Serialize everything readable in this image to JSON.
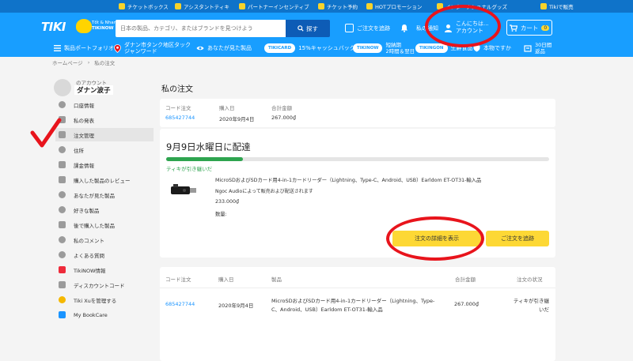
{
  "topbar": {
    "items": [
      "チケットボックス",
      "アシスタントティキ",
      "パートナーインセンティブ",
      "チケット予約",
      "HOTプロモーション",
      "インターナショナルグッズ",
      "Tikiで販売"
    ]
  },
  "header": {
    "logo": "TIKI",
    "logo_sub_1": "Tốt & Nhanh",
    "logo_sub_2": "TIKINOW",
    "search_placeholder": "日本の製品、カテゴリ、またはブランドを見つけよう",
    "search_button": "探す",
    "track_order": "ご注文を追跡",
    "notifications": "私の通知",
    "account_greeting": "こんにちは...",
    "account_label": "アカウント",
    "cart_label": "カート",
    "cart_count": "0"
  },
  "nav": {
    "categories": "製品ポートフォリオ",
    "location": "ダナン市タンク地区タック ジャンワード",
    "viewed": "あなたが見た製品",
    "tikicard_badge": "TIKICARD",
    "cashback": "15%キャッシュバック",
    "tikinow_badge": "TIKINOW",
    "tikinow_text_1": "短納期",
    "tikinow_text_2": "2時間＆翌日",
    "tikingon_badge": "TIKINGON",
    "tikingon_text": "生鮮食品",
    "genuine": "本物ですか",
    "returns_1": "30日間",
    "returns_2": "返品"
  },
  "breadcrumb": {
    "home": "ホームページ",
    "separator": "›",
    "current": "私の注文"
  },
  "sidebar": {
    "account_label": "のアカウント",
    "account_name": "ダナン波子",
    "items": [
      {
        "label": "口座情報"
      },
      {
        "label": "私の発表"
      },
      {
        "label": "注文管理"
      },
      {
        "label": "住所"
      },
      {
        "label": "課金情報"
      },
      {
        "label": "購入した製品のレビュー"
      },
      {
        "label": "あなたが見た製品"
      },
      {
        "label": "好きな製品"
      },
      {
        "label": "後で購入した製品"
      },
      {
        "label": "私のコメント"
      },
      {
        "label": "よくある質問"
      },
      {
        "label": "TikiNOW情報"
      },
      {
        "label": "ディスカウントコード"
      },
      {
        "label": "Tiki Xuを管理する"
      },
      {
        "label": "My BookCare"
      }
    ]
  },
  "main": {
    "title": "私の注文",
    "order_card": {
      "headers": [
        "コード注文",
        "購入日",
        "合計金額"
      ],
      "order_code": "685427744",
      "order_date": "2020年9月4日",
      "order_total": "267.000₫"
    },
    "delivery": {
      "title": "9月9日水曜日に配達",
      "progress": 0.2,
      "status": "ティキが引き継いだ",
      "product_name": "MicroSDおよびSDカード用4-in-1カードリーダー（Lightning、Type-C、Android、USB）Earldom ET-OT31-輸入品",
      "seller": "Ngoc Audioによって販売および配送されます",
      "price": "233.000₫",
      "quantity_label": "数量:",
      "details_button": "注文の詳細を表示",
      "track_button": "ご注文を追跡"
    },
    "table": {
      "headers": [
        "コード注文",
        "購入日",
        "製品",
        "合計金額",
        "注文の状況"
      ],
      "rows": [
        {
          "code": "685427744",
          "date": "2020年9月4日",
          "product": "MicroSDおよびSDカード用4-in-1カードリーダー（Lightning、Type-C、Android、USB）Earldom ET-OT31-輸入品",
          "total": "267.000₫",
          "status": "ティキが引き継いだ"
        }
      ]
    }
  },
  "colors": {
    "header_blue": "#189eff",
    "topbar_blue": "#0f73c9",
    "accent_yellow": "#fdd835",
    "link_blue": "#1a94ff",
    "progress_green": "#2ea44f",
    "annotation_red": "#e8141c"
  }
}
